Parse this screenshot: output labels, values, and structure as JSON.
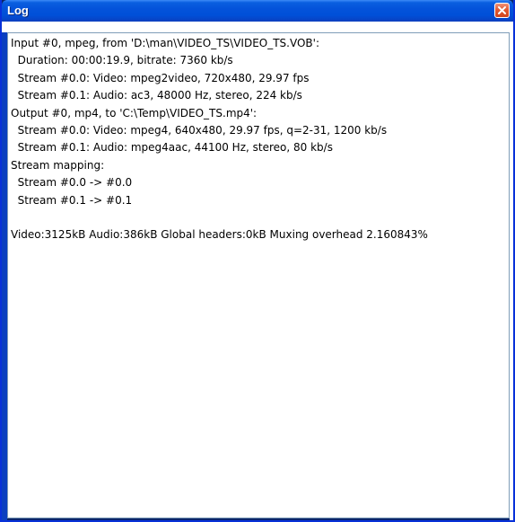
{
  "window": {
    "title": "Log"
  },
  "log": {
    "lines": [
      "Input #0, mpeg, from 'D:\\man\\VIDEO_TS\\VIDEO_TS.VOB':",
      "  Duration: 00:00:19.9, bitrate: 7360 kb/s",
      "  Stream #0.0: Video: mpeg2video, 720x480, 29.97 fps",
      "  Stream #0.1: Audio: ac3, 48000 Hz, stereo, 224 kb/s",
      "Output #0, mp4, to 'C:\\Temp\\VIDEO_TS.mp4':",
      "  Stream #0.0: Video: mpeg4, 640x480, 29.97 fps, q=2-31, 1200 kb/s",
      "  Stream #0.1: Audio: mpeg4aac, 44100 Hz, stereo, 80 kb/s",
      "Stream mapping:",
      "  Stream #0.0 -> #0.0",
      "  Stream #0.1 -> #0.1",
      "",
      "Video:3125kB Audio:386kB Global headers:0kB Muxing overhead 2.160843%"
    ]
  },
  "icons": {
    "close": "close-icon"
  },
  "colors": {
    "titlebar": "#0453da",
    "close_button": "#e25a32",
    "log_background": "#ffffff"
  }
}
